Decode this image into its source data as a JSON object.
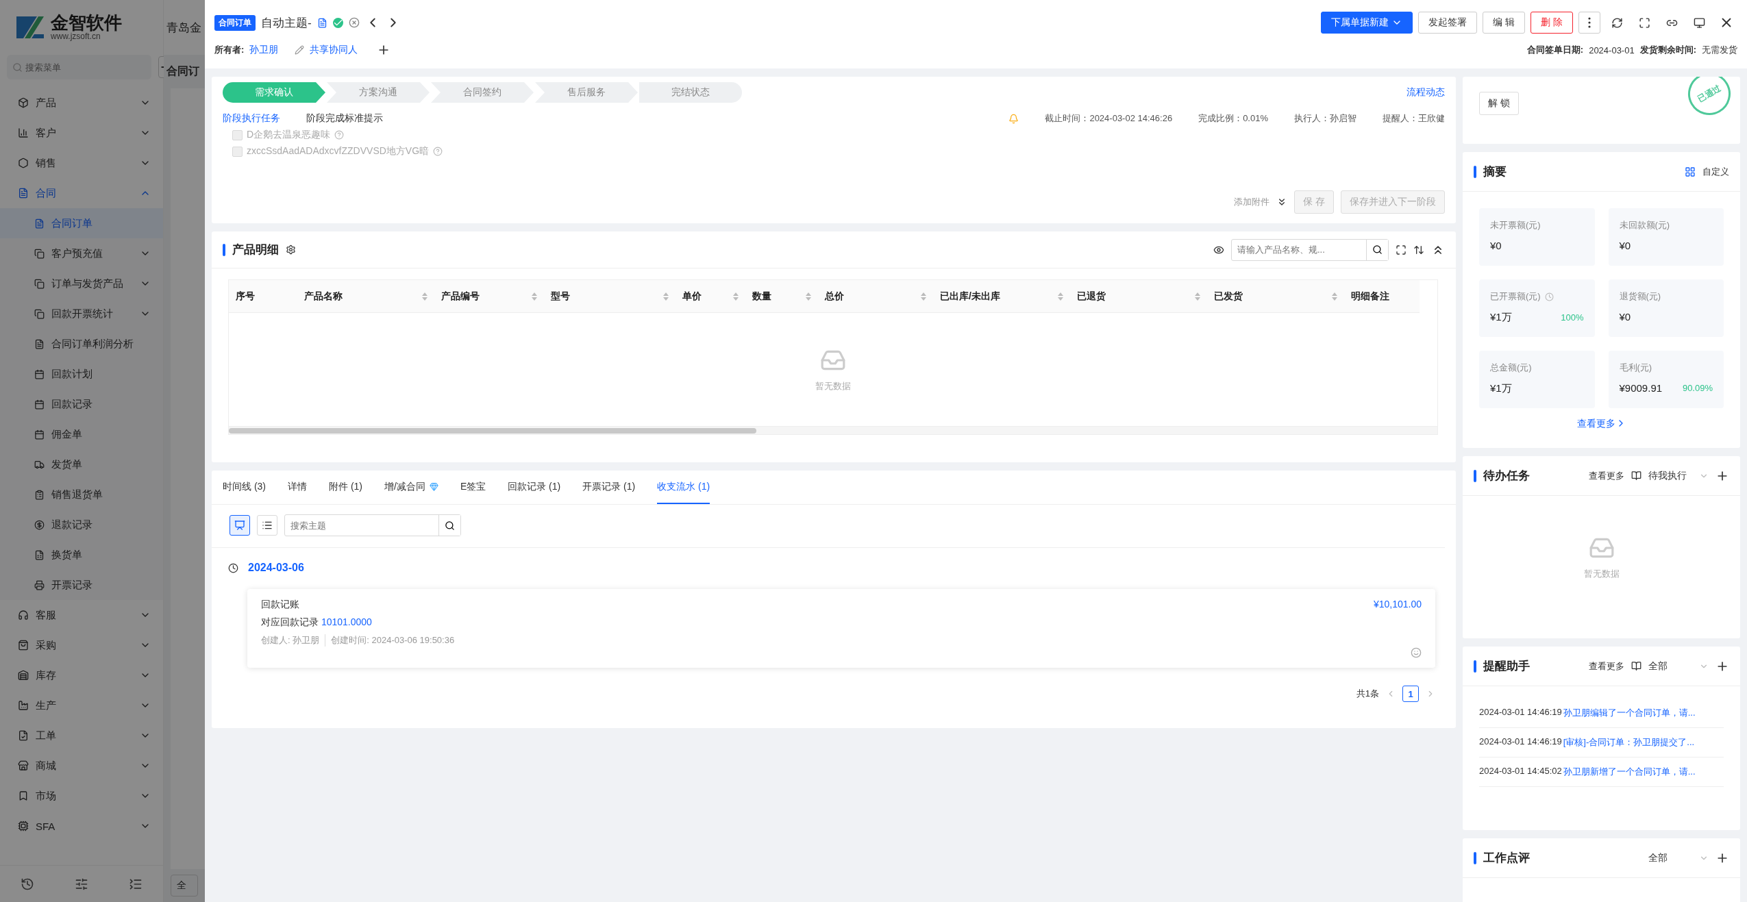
{
  "app": {
    "logo_name": "金智软件",
    "logo_url": "www.jzsoft.cn",
    "search_placeholder": "搜索菜单",
    "company": "青岛金",
    "page_title": "合同订",
    "footer_button": "全"
  },
  "sidebar": {
    "items": [
      {
        "label": "产品",
        "expanded": false,
        "selected": false
      },
      {
        "label": "客户",
        "expanded": false,
        "selected": false
      },
      {
        "label": "销售",
        "expanded": false,
        "selected": false
      },
      {
        "label": "合同",
        "expanded": true,
        "selected": true,
        "children": [
          {
            "label": "合同订单",
            "selected": true,
            "has_children": false
          },
          {
            "label": "客户预充值",
            "selected": false,
            "has_children": true
          },
          {
            "label": "订单与发货产品",
            "selected": false,
            "has_children": true
          },
          {
            "label": "回款开票统计",
            "selected": false,
            "has_children": true
          },
          {
            "label": "合同订单利润分析",
            "selected": false,
            "has_children": false
          },
          {
            "label": "回款计划",
            "selected": false,
            "has_children": false
          },
          {
            "label": "回款记录",
            "selected": false,
            "has_children": false
          },
          {
            "label": "佣金单",
            "selected": false,
            "has_children": false
          },
          {
            "label": "发货单",
            "selected": false,
            "has_children": false
          },
          {
            "label": "销售退货单",
            "selected": false,
            "has_children": false
          },
          {
            "label": "退款记录",
            "selected": false,
            "has_children": false
          },
          {
            "label": "换货单",
            "selected": false,
            "has_children": false
          },
          {
            "label": "开票记录",
            "selected": false,
            "has_children": false
          }
        ]
      },
      {
        "label": "客服",
        "expanded": false,
        "selected": false
      },
      {
        "label": "采购",
        "expanded": false,
        "selected": false
      },
      {
        "label": "库存",
        "expanded": false,
        "selected": false
      },
      {
        "label": "生产",
        "expanded": false,
        "selected": false
      },
      {
        "label": "工单",
        "expanded": false,
        "selected": false
      },
      {
        "label": "商城",
        "expanded": false,
        "selected": false
      },
      {
        "label": "市场",
        "expanded": false,
        "selected": false
      },
      {
        "label": "SFA",
        "expanded": false,
        "selected": false
      }
    ]
  },
  "header": {
    "badge": "合同订单",
    "title": "自动主题-",
    "owner_label": "所有者:",
    "owner": "孙卫朋",
    "share": "共享协同人",
    "actions": [
      {
        "label": "下属单据新建",
        "kind": "primary"
      },
      {
        "label": "发起签署",
        "kind": "default"
      },
      {
        "label": "编 辑",
        "kind": "default"
      },
      {
        "label": "删 除",
        "kind": "danger"
      }
    ],
    "sign_date_label": "合同签单日期:",
    "sign_date": "2024-03-01",
    "remaining_label": "发货剩余时间:",
    "remaining": "无需发货"
  },
  "stage": {
    "steps": [
      {
        "label": "需求确认",
        "selected": true
      },
      {
        "label": "方案沟通",
        "selected": false
      },
      {
        "label": "合同签约",
        "selected": false
      },
      {
        "label": "售后服务",
        "selected": false
      },
      {
        "label": "完结状态",
        "selected": false
      }
    ],
    "flow_link": "流程动态",
    "tabs": [
      {
        "label": "阶段执行任务",
        "selected": true
      },
      {
        "label": "阶段完成标准提示",
        "selected": false
      }
    ],
    "info": [
      "截止时间：2024-03-02 14:46:26",
      "完成比例：0.01%",
      "执行人：孙启智",
      "提醒人：王欣健"
    ],
    "tasks": [
      {
        "label": "D企鹅去温泉恶趣味",
        "checked": false,
        "disabled": true
      },
      {
        "label": "zxccSsdAadADAdxcvfZZDVVSD地方VG暗",
        "checked": false,
        "disabled": true
      }
    ],
    "attach": "添加附件",
    "buttons": [
      {
        "label": "保 存",
        "disabled": true
      },
      {
        "label": "保存并进入下一阶段",
        "disabled": true
      }
    ]
  },
  "products": {
    "title": "产品明细",
    "search_placeholder": "请输入产品名称、规...",
    "columns": [
      {
        "label": "序号",
        "sortable": false
      },
      {
        "label": "产品名称",
        "sortable": true
      },
      {
        "label": "产品编号",
        "sortable": true
      },
      {
        "label": "型号",
        "sortable": true
      },
      {
        "label": "单价",
        "sortable": true
      },
      {
        "label": "数量",
        "sortable": true
      },
      {
        "label": "总价",
        "sortable": true
      },
      {
        "label": "已出库/未出库",
        "sortable": true
      },
      {
        "label": "已退货",
        "sortable": true
      },
      {
        "label": "已发货",
        "sortable": true
      },
      {
        "label": "明细备注",
        "sortable": false
      }
    ],
    "empty": "暂无数据"
  },
  "records": {
    "tabs": [
      {
        "label": "时间线 (3)",
        "selected": false
      },
      {
        "label": "详情",
        "selected": false
      },
      {
        "label": "附件 (1)",
        "selected": false
      },
      {
        "label": "增/减合同",
        "selected": false,
        "premium": true
      },
      {
        "label": "E签宝",
        "selected": false
      },
      {
        "label": "回款记录 (1)",
        "selected": false
      },
      {
        "label": "开票记录 (1)",
        "selected": false
      },
      {
        "label": "收支流水 (1)",
        "selected": true
      }
    ],
    "views": [
      {
        "kind": "timeline",
        "selected": true
      },
      {
        "kind": "list",
        "selected": false
      }
    ],
    "search_placeholder": "搜索主题",
    "groups": [
      {
        "date": "2024-03-06",
        "entries": [
          {
            "title": "回款记账",
            "amount": "¥10,101.00",
            "link_label": "对应回款记录",
            "link": "10101.0000",
            "creator": "创建人: 孙卫朋",
            "created": "创建时间: 2024-03-06 19:50:36"
          }
        ]
      }
    ],
    "total": "共1条",
    "pages": [
      {
        "label": "1",
        "selected": true
      }
    ]
  },
  "side": {
    "unlock": "解 锁",
    "stamp": "已通过",
    "summary": {
      "title": "摘要",
      "customize": "自定义",
      "cards": [
        {
          "label": "未开票额(元)",
          "value": "¥0"
        },
        {
          "label": "未回款额(元)",
          "value": "¥0"
        },
        {
          "label": "已开票额(元)",
          "value": "¥1万",
          "percent": "100%",
          "clock": true
        },
        {
          "label": "退货额(元)",
          "value": "¥0"
        },
        {
          "label": "总金额(元)",
          "value": "¥1万"
        },
        {
          "label": "毛利(元)",
          "value": "¥9009.91",
          "percent": "90.09%"
        }
      ],
      "more": "查看更多"
    },
    "todo": {
      "title": "待办任务",
      "more": "查看更多",
      "filter": "待我执行",
      "empty": "暂无数据"
    },
    "reminder": {
      "title": "提醒助手",
      "more": "查看更多",
      "filter": "全部",
      "items": [
        {
          "time": "2024-03-01 14:46:19",
          "text": "孙卫朋编辑了一个合同订单，请..."
        },
        {
          "time": "2024-03-01 14:46:19",
          "text": "[审核]-合同订单：孙卫朋提交了..."
        },
        {
          "time": "2024-03-01 14:45:02",
          "text": "孙卫朋新增了一个合同订单，请..."
        }
      ]
    },
    "review": {
      "title": "工作点评",
      "filter": "全部"
    }
  }
}
